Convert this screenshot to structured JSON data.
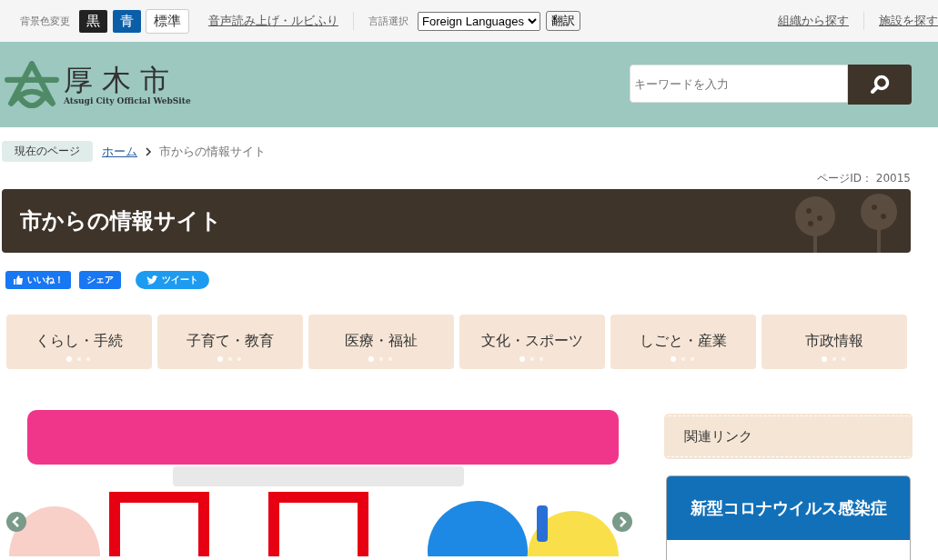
{
  "top_bar": {
    "bg_label": "背景色変更",
    "bg_buttons": [
      {
        "label": "黒",
        "kind": "black",
        "selected": false
      },
      {
        "label": "青",
        "kind": "blue",
        "selected": false
      },
      {
        "label": "標準",
        "kind": "standard",
        "selected": true
      }
    ],
    "read_aloud_link": "音声読み上げ・ルビふり",
    "language_label": "言語選択",
    "language_select": "Foreign Languages",
    "translate_button": "翻訳",
    "links": [
      "組織から探す",
      "施設を探す"
    ]
  },
  "header": {
    "logo_title": "厚木市",
    "logo_subtitle": "Atsugi City Official WebSite",
    "search": {
      "placeholder": "キーワードを入力"
    }
  },
  "breadcrumb": {
    "label": "現在のページ",
    "items": [
      {
        "text": "ホーム",
        "kind": "link"
      },
      {
        "text": "市からの情報サイト",
        "kind": "current"
      }
    ]
  },
  "page_id": "ページID： 20015",
  "page_title": "市からの情報サイト",
  "social": [
    {
      "label": "いいね！",
      "kind": "like"
    },
    {
      "label": "シェア",
      "kind": "share"
    },
    {
      "label": "ツイート",
      "kind": "tweet"
    }
  ],
  "categories": [
    "くらし・手続",
    "子育て・教育",
    "医療・福祉",
    "文化・スポーツ",
    "しごと・産業",
    "市政情報"
  ],
  "sidebar": {
    "related_heading": "関連リンク",
    "corona_heading": "新型コロナウイルス感染症"
  }
}
